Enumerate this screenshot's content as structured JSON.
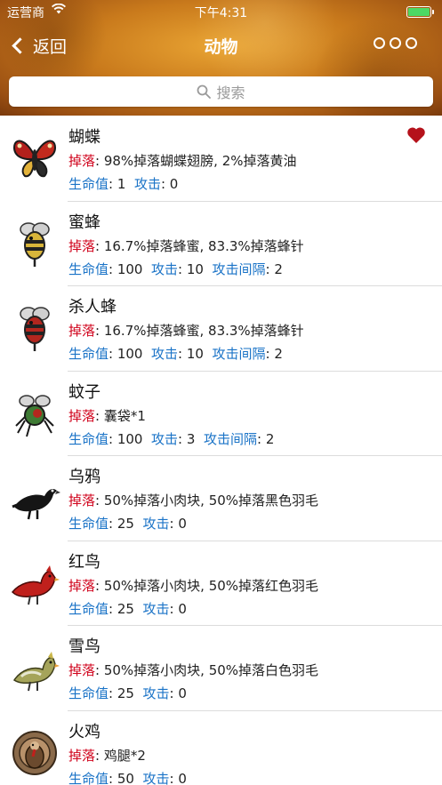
{
  "status_bar": {
    "carrier": "运营商",
    "time": "下午4:31"
  },
  "nav": {
    "back_label": "返回",
    "title": "动物"
  },
  "search": {
    "placeholder": "搜索"
  },
  "labels": {
    "drops": "掉落",
    "health": "生命值",
    "attack": "攻击",
    "attack_interval": "攻击间隔"
  },
  "animals": [
    {
      "name": "蝴蝶",
      "drops": "98%掉落蝴蝶翅膀, 2%掉落黄油",
      "health": "1",
      "attack": "0",
      "interval": null,
      "favorite": true,
      "icon": "butterfly-icon"
    },
    {
      "name": "蜜蜂",
      "drops": "16.7%掉落蜂蜜, 83.3%掉落蜂针",
      "health": "100",
      "attack": "10",
      "interval": "2",
      "favorite": false,
      "icon": "bee-icon"
    },
    {
      "name": "杀人蜂",
      "drops": "16.7%掉落蜂蜜, 83.3%掉落蜂针",
      "health": "100",
      "attack": "10",
      "interval": "2",
      "favorite": false,
      "icon": "killer-bee-icon"
    },
    {
      "name": "蚊子",
      "drops": "囊袋*1",
      "health": "100",
      "attack": "3",
      "interval": "2",
      "favorite": false,
      "icon": "mosquito-icon"
    },
    {
      "name": "乌鸦",
      "drops": "50%掉落小肉块, 50%掉落黑色羽毛",
      "health": "25",
      "attack": "0",
      "interval": null,
      "favorite": false,
      "icon": "crow-icon"
    },
    {
      "name": "红鸟",
      "drops": "50%掉落小肉块, 50%掉落红色羽毛",
      "health": "25",
      "attack": "0",
      "interval": null,
      "favorite": false,
      "icon": "redbird-icon"
    },
    {
      "name": "雪鸟",
      "drops": "50%掉落小肉块, 50%掉落白色羽毛",
      "health": "25",
      "attack": "0",
      "interval": null,
      "favorite": false,
      "icon": "snowbird-icon"
    },
    {
      "name": "火鸡",
      "drops": "鸡腿*2",
      "health": "50",
      "attack": "0",
      "interval": null,
      "favorite": false,
      "icon": "turkey-icon"
    }
  ],
  "colors": {
    "drops_label": "#d0021b",
    "stat_label": "#1a73c7",
    "heart": "#b5121b",
    "header": "#c97a1c"
  }
}
